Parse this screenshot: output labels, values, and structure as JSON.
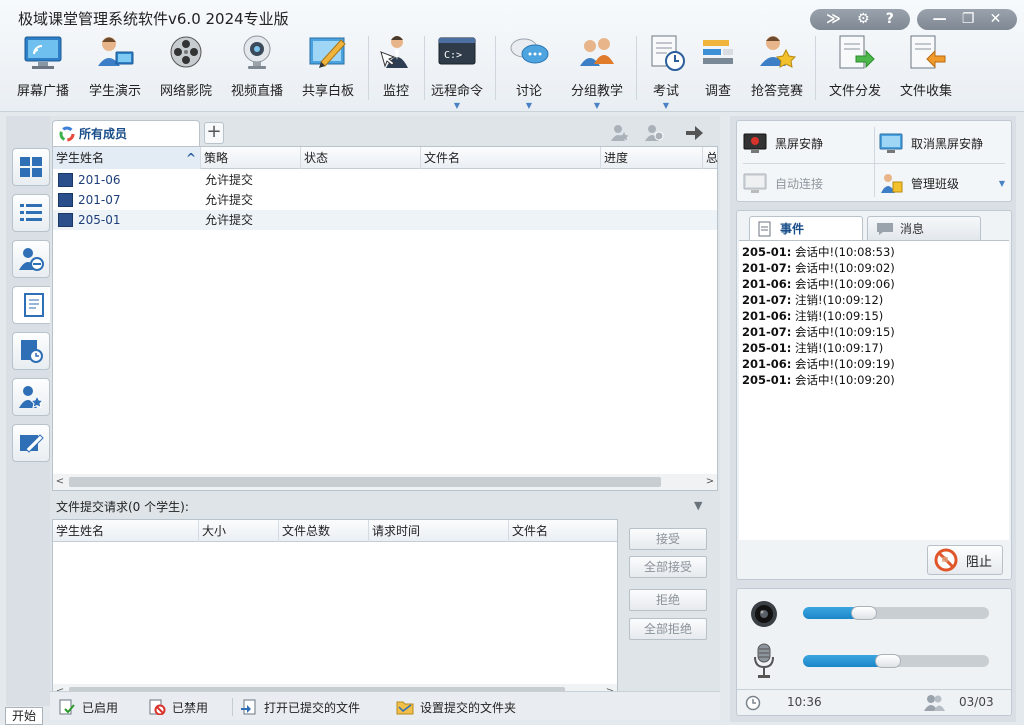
{
  "window": {
    "title": "极域课堂管理系统软件v6.0 2024专业版",
    "controls": {
      "collapse": "≫",
      "settings": "⚙",
      "help": "?",
      "minimize": "—",
      "restore": "❐",
      "close": "✕"
    }
  },
  "toolbar": {
    "items": [
      {
        "label": "屏幕广播",
        "icon": "broadcast-screen-icon"
      },
      {
        "label": "学生演示",
        "icon": "student-demo-icon"
      },
      {
        "label": "网络影院",
        "icon": "film-reel-icon"
      },
      {
        "label": "视频直播",
        "icon": "webcam-icon"
      },
      {
        "label": "共享白板",
        "icon": "whiteboard-icon"
      },
      {
        "label": "监控",
        "icon": "monitor-person-icon"
      },
      {
        "label": "远程命令",
        "icon": "cmd-terminal-icon",
        "dropdown": true
      },
      {
        "label": "讨论",
        "icon": "discussion-bubbles-icon",
        "dropdown": true
      },
      {
        "label": "分组教学",
        "icon": "group-teaching-icon",
        "dropdown": true
      },
      {
        "label": "考试",
        "icon": "exam-clock-icon",
        "dropdown": true
      },
      {
        "label": "调查",
        "icon": "survey-bars-icon"
      },
      {
        "label": "抢答竞赛",
        "icon": "quiz-contest-icon"
      },
      {
        "label": "文件分发",
        "icon": "file-distribute-icon"
      },
      {
        "label": "文件收集",
        "icon": "file-collect-icon"
      }
    ]
  },
  "left_tabs": [
    {
      "name": "thumbnail-view-icon"
    },
    {
      "name": "list-view-icon"
    },
    {
      "name": "user-remove-icon"
    },
    {
      "name": "document-icon",
      "active": true
    },
    {
      "name": "document-clock-icon"
    },
    {
      "name": "user-star-icon"
    },
    {
      "name": "edit-board-icon"
    }
  ],
  "members": {
    "tab_label": "所有成员",
    "columns": [
      "学生姓名",
      "策略",
      "状态",
      "文件名",
      "进度",
      "总"
    ],
    "rows": [
      {
        "name": "201-06",
        "strategy": "允许提交",
        "status": "",
        "filename": "",
        "progress": ""
      },
      {
        "name": "201-07",
        "strategy": "允许提交",
        "status": "",
        "filename": "",
        "progress": ""
      },
      {
        "name": "205-01",
        "strategy": "允许提交",
        "status": "",
        "filename": "",
        "progress": ""
      }
    ]
  },
  "requests": {
    "title": "文件提交请求(0 个学生):",
    "columns": [
      "学生姓名",
      "大小",
      "文件总数",
      "请求时间",
      "文件名"
    ],
    "buttons": {
      "accept": "接受",
      "accept_all": "全部接受",
      "reject": "拒绝",
      "reject_all": "全部拒绝"
    }
  },
  "bottom_bar": {
    "enabled": "已启用",
    "disabled": "已禁用",
    "open_submitted": "打开已提交的文件",
    "set_folder": "设置提交的文件夹"
  },
  "quick_actions": {
    "black_screen": "黑屏安静",
    "cancel_black_screen": "取消黑屏安静",
    "auto_connect": "自动连接",
    "manage_class": "管理班级"
  },
  "events": {
    "tab_events": "事件",
    "tab_messages": "消息",
    "lines": [
      {
        "who": "205-01:",
        "msg": " 会话中!(10:08:53)"
      },
      {
        "who": "201-07:",
        "msg": " 会话中!(10:09:02)"
      },
      {
        "who": "201-06:",
        "msg": " 会话中!(10:09:06)"
      },
      {
        "who": "201-07:",
        "msg": " 注销!(10:09:12)"
      },
      {
        "who": "201-06:",
        "msg": " 注销!(10:09:15)"
      },
      {
        "who": "201-07:",
        "msg": " 会话中!(10:09:15)"
      },
      {
        "who": "205-01:",
        "msg": " 注销!(10:09:17)"
      },
      {
        "who": "201-06:",
        "msg": " 会话中!(10:09:19)"
      },
      {
        "who": "205-01:",
        "msg": " 会话中!(10:09:20)"
      }
    ],
    "stop_button": "阻止"
  },
  "media": {
    "speaker_level": 0.3,
    "mic_level": 0.45
  },
  "status": {
    "time": "10:36",
    "count": "03/03"
  },
  "taskbar": {
    "start": "开始"
  },
  "colors": {
    "accent": "#1c86c8",
    "link_text": "#1f3f7a",
    "header_bg": "#eaeff4"
  }
}
